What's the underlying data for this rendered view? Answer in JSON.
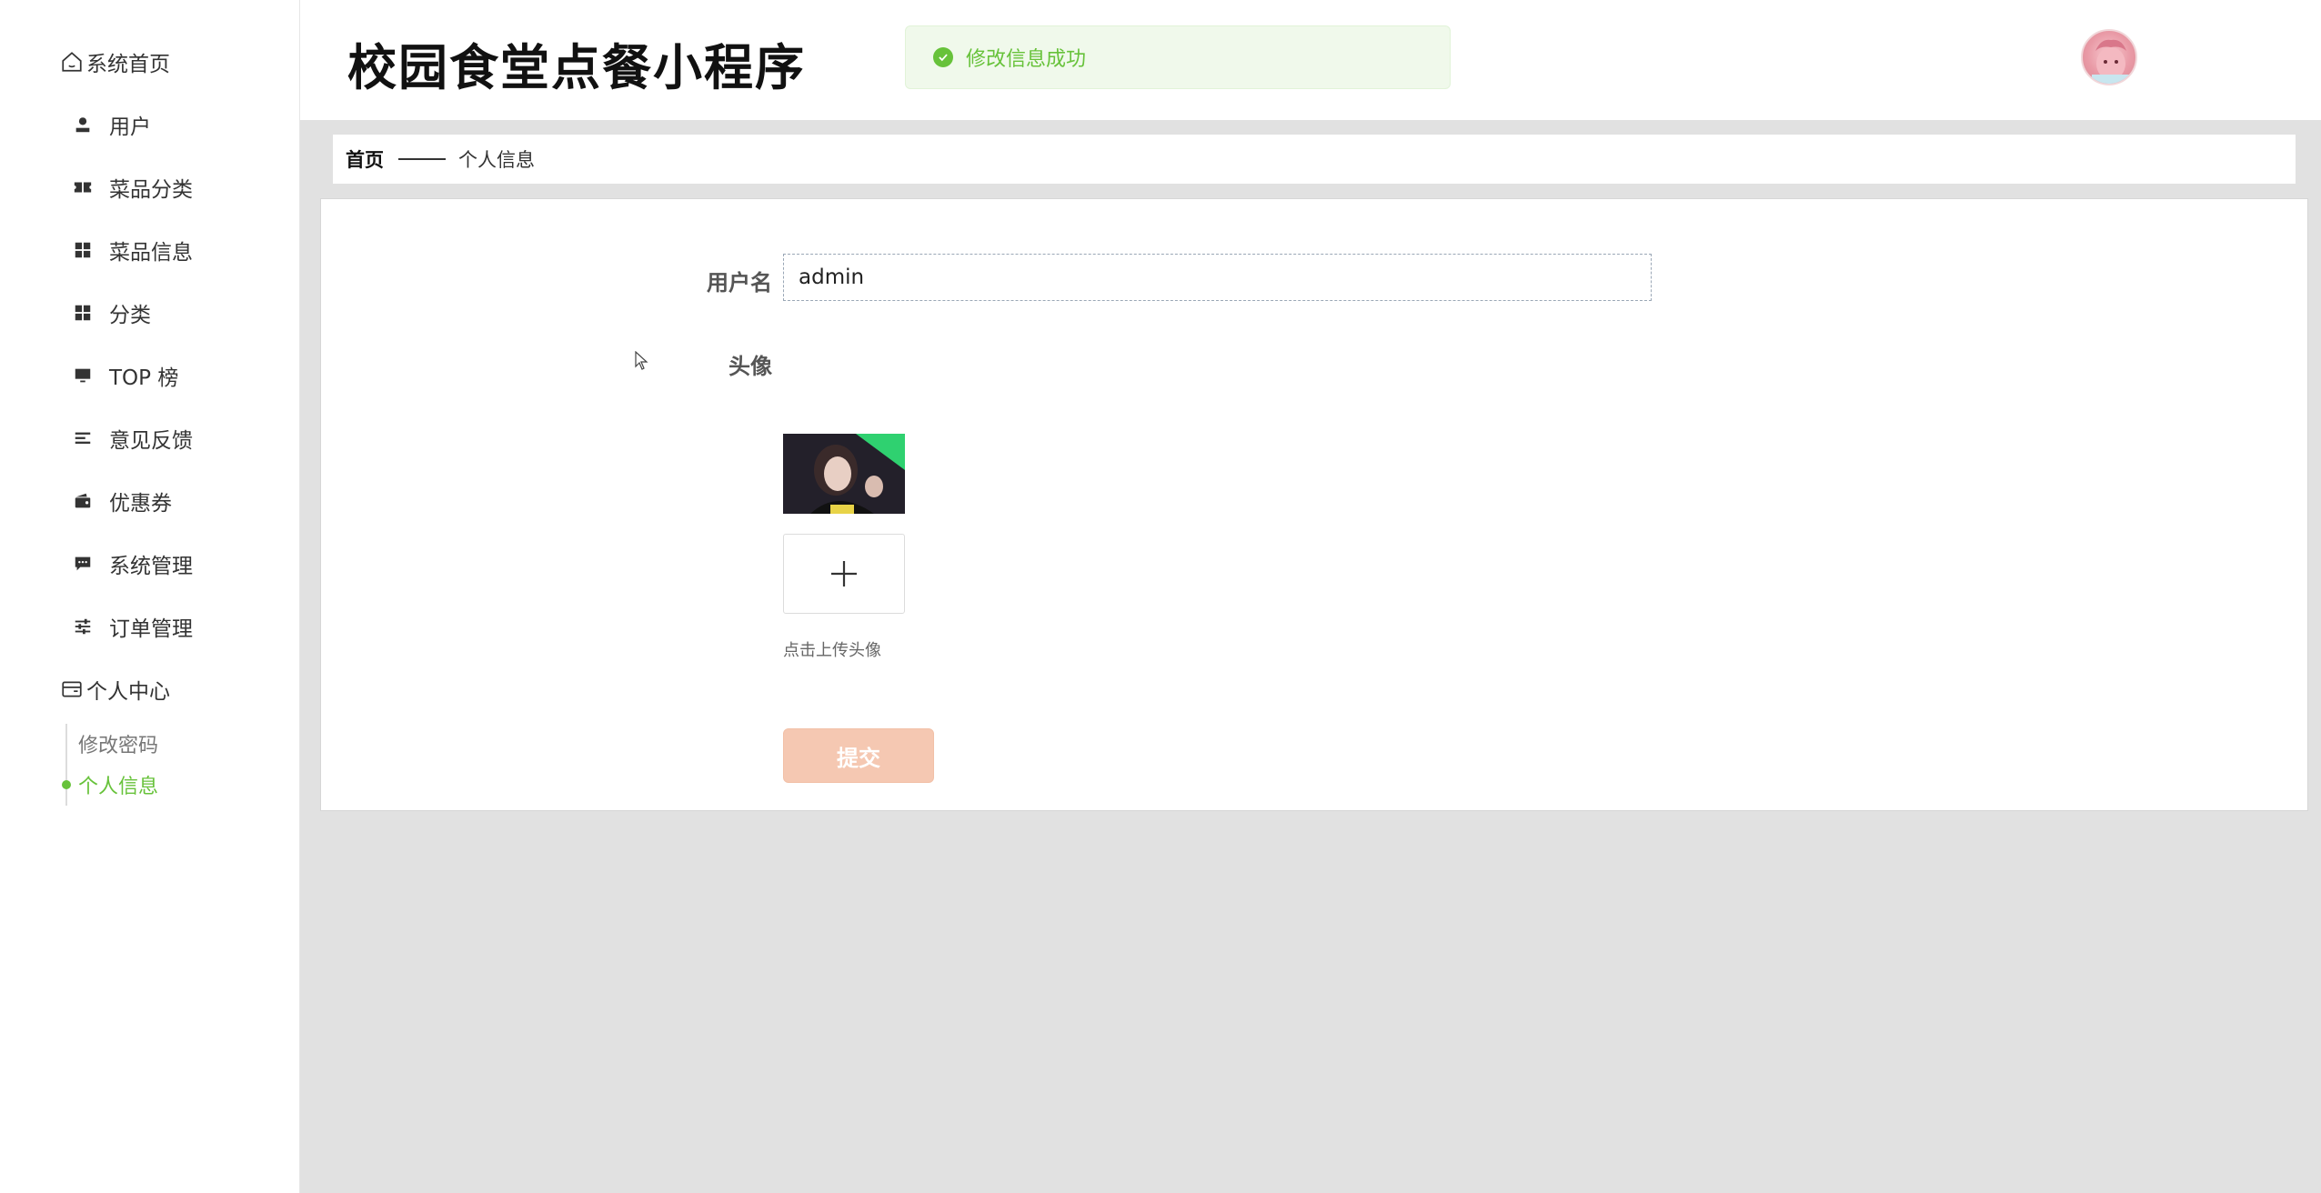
{
  "app_title": "校园食堂点餐小程序",
  "toast": {
    "message": "修改信息成功",
    "color": "#67c23a"
  },
  "sidebar": {
    "home": "系统首页",
    "items": [
      {
        "label": "用户",
        "icon": "user-icon"
      },
      {
        "label": "菜品分类",
        "icon": "ticket-icon"
      },
      {
        "label": "菜品信息",
        "icon": "grid-icon"
      },
      {
        "label": "分类",
        "icon": "grid-icon"
      },
      {
        "label": "TOP 榜",
        "icon": "monitor-icon"
      },
      {
        "label": "意见反馈",
        "icon": "list-icon"
      },
      {
        "label": "优惠券",
        "icon": "wallet-icon"
      },
      {
        "label": "系统管理",
        "icon": "chat-icon"
      },
      {
        "label": "订单管理",
        "icon": "sliders-icon"
      }
    ],
    "personal_center": "个人中心",
    "sub_items": [
      {
        "label": "修改密码",
        "active": false
      },
      {
        "label": "个人信息",
        "active": true
      }
    ]
  },
  "breadcrumb": {
    "home": "首页",
    "current": "个人信息"
  },
  "form": {
    "username_label": "用户名",
    "username_value": "admin",
    "avatar_label": "头像",
    "upload_hint": "点击上传头像",
    "submit_label": "提交"
  },
  "colors": {
    "accent": "#67c23a",
    "submit_bg": "#f5c8b2",
    "background": "#e1e1e1"
  }
}
